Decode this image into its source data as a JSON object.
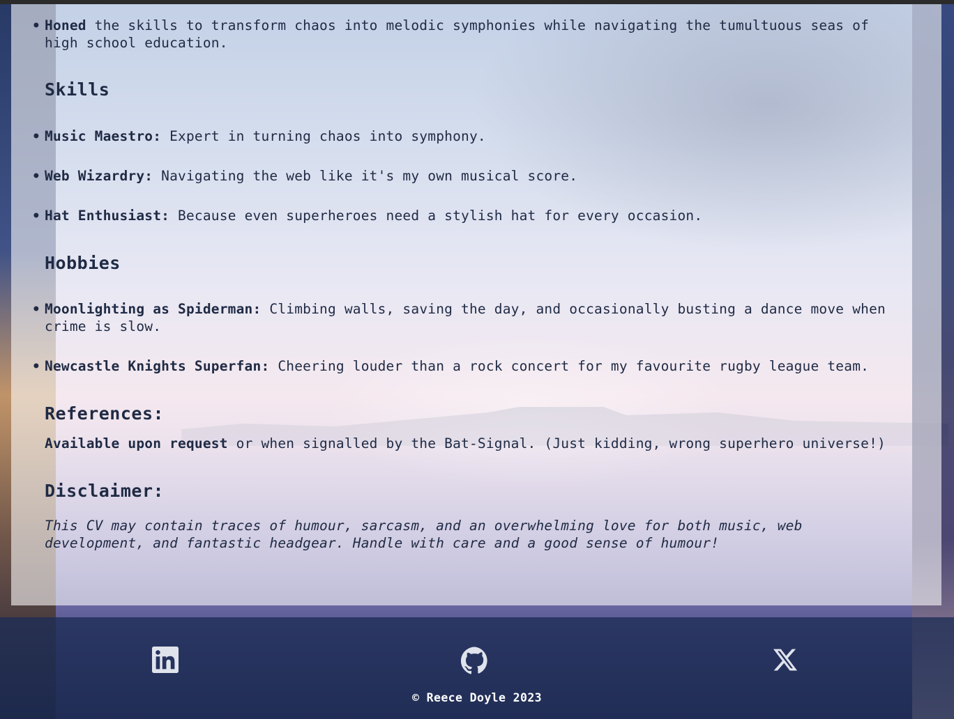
{
  "education": {
    "items": [
      {
        "bold": "Honed",
        "text": " the skills to transform chaos into melodic symphonies while navigating the tumultuous seas of high school education."
      }
    ]
  },
  "skills": {
    "heading": "Skills",
    "items": [
      {
        "bold": "Music Maestro:",
        "text": " Expert in turning chaos into symphony."
      },
      {
        "bold": "Web Wizardry:",
        "text": " Navigating the web like it's my own musical score."
      },
      {
        "bold": "Hat Enthusiast:",
        "text": " Because even superheroes need a stylish hat for every occasion."
      }
    ]
  },
  "hobbies": {
    "heading": "Hobbies",
    "items": [
      {
        "bold": "Moonlighting as Spiderman:",
        "text": " Climbing walls, saving the day, and occasionally busting a dance move when crime is slow."
      },
      {
        "bold": "Newcastle Knights Superfan:",
        "text": " Cheering louder than a rock concert for my favourite rugby league team."
      }
    ]
  },
  "references": {
    "heading": "References:",
    "bold": "Available upon request",
    "text": " or when signalled by the Bat-Signal. (Just kidding, wrong superhero universe!)"
  },
  "disclaimer": {
    "heading": "Disclaimer:",
    "text": "This CV may contain traces of humour, sarcasm, and an overwhelming love for both music, web development, and fantastic headgear. Handle with care and a good sense of humour!"
  },
  "footer": {
    "icons": [
      "linkedin-icon",
      "github-icon",
      "x-icon"
    ],
    "copyright": "© Reece Doyle 2023",
    "icon_color": "#dfe3ec"
  }
}
